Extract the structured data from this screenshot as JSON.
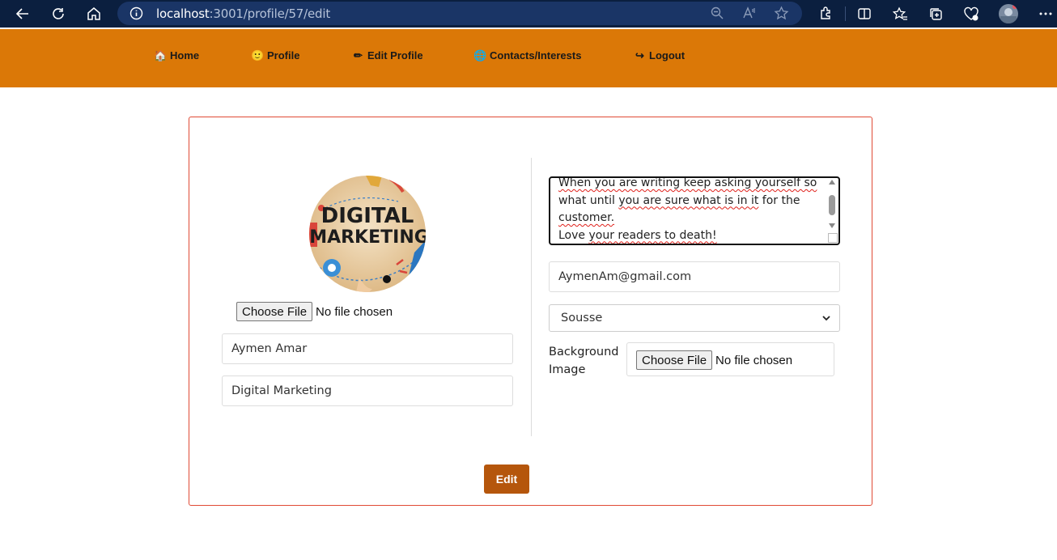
{
  "browser": {
    "url_host": "localhost",
    "url_path": ":3001/profile/57/edit"
  },
  "nav": {
    "items": [
      {
        "icon": "🏠",
        "label": "Home"
      },
      {
        "icon": "🙂",
        "label": "Profile"
      },
      {
        "icon": "✏",
        "label": "Edit Profile"
      },
      {
        "icon": "🌐",
        "label": "Contacts/Interests"
      },
      {
        "icon": "↪",
        "label": "Logout"
      }
    ]
  },
  "form": {
    "avatar_text_line1": "DIGITAL",
    "avatar_text_line2": "MARKETING",
    "photo_file_button": "Choose File",
    "photo_file_status": "No file chosen",
    "name_value": "Aymen Amar",
    "title_value": "Digital Marketing",
    "bio_lines": [
      "When you are writing keep asking yourself so",
      "what until you are sure what is in it for the",
      "customer.",
      "Love your readers to death!"
    ],
    "email_value": "AymenAm@gmail.com",
    "city_selected": "Sousse",
    "background_label": "Background Image",
    "background_file_button": "Choose File",
    "background_file_status": "No file chosen",
    "submit_label": "Edit"
  },
  "colors": {
    "navbar": "#db7807",
    "card_border": "#e04a35",
    "submit_button": "#b5560c",
    "chrome": "#0b1f3f"
  }
}
